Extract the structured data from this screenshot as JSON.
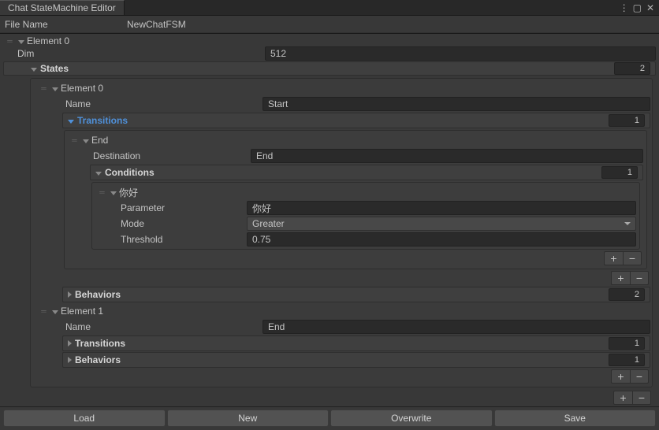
{
  "window": {
    "title": "Chat StateMachine Editor"
  },
  "fileName": {
    "label": "File Name",
    "value": "NewChatFSM"
  },
  "elements": [
    {
      "label": "Element 0",
      "dim": {
        "label": "Dim",
        "value": "512"
      },
      "states": {
        "label": "States",
        "count": "2",
        "items": [
          {
            "label": "Element 0",
            "name": {
              "label": "Name",
              "value": "Start"
            },
            "transitions": {
              "label": "Transitions",
              "count": "1",
              "items": [
                {
                  "label": "End",
                  "destination": {
                    "label": "Destination",
                    "value": "End"
                  },
                  "conditions": {
                    "label": "Conditions",
                    "count": "1",
                    "items": [
                      {
                        "label": "你好",
                        "parameter": {
                          "label": "Parameter",
                          "value": "你好"
                        },
                        "mode": {
                          "label": "Mode",
                          "value": "Greater"
                        },
                        "threshold": {
                          "label": "Threshold",
                          "value": "0.75"
                        }
                      }
                    ]
                  }
                }
              ]
            },
            "behaviors": {
              "label": "Behaviors",
              "count": "2"
            }
          },
          {
            "label": "Element 1",
            "name": {
              "label": "Name",
              "value": "End"
            },
            "transitions": {
              "label": "Transitions",
              "count": "1"
            },
            "behaviors": {
              "label": "Behaviors",
              "count": "1"
            }
          }
        ]
      }
    }
  ],
  "footer": {
    "load": "Load",
    "new": "New",
    "overwrite": "Overwrite",
    "save": "Save"
  }
}
